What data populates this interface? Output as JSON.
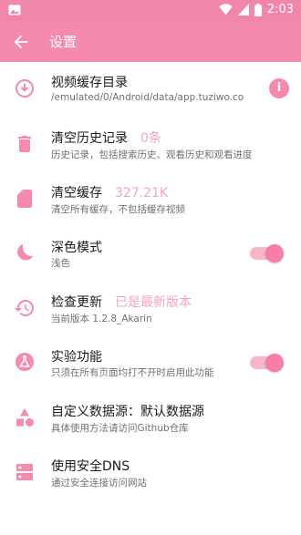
{
  "status_bar": {
    "time": "2:03"
  },
  "app_bar": {
    "title": "设置"
  },
  "colors": {
    "accent": "#f58aae",
    "accent_light": "#f6a3c0"
  },
  "settings": [
    {
      "title": "视频缓存目录",
      "subtitle": "/emulated/0/Android/data/app.tuziwo.co",
      "icon": "download-circle-icon"
    },
    {
      "title": "清空历史记录",
      "value": "0条",
      "subtitle": "历史记录，包括搜索历史、观看历史和观看进度",
      "icon": "trash-icon"
    },
    {
      "title": "清空缓存",
      "value": "327.21K",
      "subtitle": "清空所有缓存，不包括缓存视频",
      "icon": "sd-card-icon"
    },
    {
      "title": "深色模式",
      "subtitle": "浅色",
      "icon": "moon-icon",
      "toggle_on": true
    },
    {
      "title": "检查更新",
      "value": "已是最新版本",
      "subtitle": "当前版本 1.2.8_Akarin",
      "icon": "history-icon"
    },
    {
      "title": "实验功能",
      "subtitle": "只须在所有页面均打不开时启用此功能",
      "icon": "science-icon",
      "toggle_on": true
    },
    {
      "title": "自定义数据源：默认数据源",
      "subtitle": "具体使用方法请访问Github仓库",
      "icon": "shapes-icon"
    },
    {
      "title": "使用安全DNS",
      "subtitle": "通过安全连接访问网站",
      "icon": "dns-icon"
    }
  ],
  "info_button": {
    "label": "i"
  }
}
